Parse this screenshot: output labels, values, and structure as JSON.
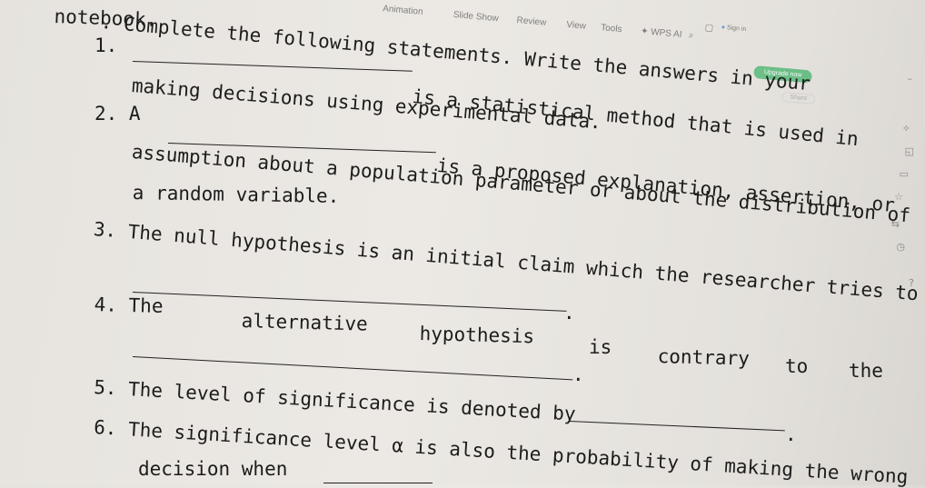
{
  "menu": {
    "animation": "Animation",
    "slide_show": "Slide Show",
    "review": "Review",
    "view": "View",
    "tools": "Tools",
    "wps_ai": "WPS AI",
    "sign_in": "Sign in",
    "upgrade": "Upgrade now",
    "share": "Share"
  },
  "worksheet": {
    "header_word": "notebook.",
    "q1_number": "1.",
    "instruction": "Complete the following statements. Write the answers in your",
    "q1_line1": "is a statistical method that is used in",
    "q1_line2": "making decisions using experimental data.",
    "q2_number": "2. A",
    "q2_line1": "is a proposed explanation, assertion, or",
    "q2_line2": "assumption about a population parameter or about the distribution of",
    "q2_line3": "a random variable.",
    "q3_line1": "3. The null hypothesis is an initial claim which the researcher tries to",
    "q4_the": "4. The",
    "q4_alternative": "alternative",
    "q4_hypothesis": "hypothesis",
    "q4_is": "is",
    "q4_contrary": "contrary",
    "q4_to": "to",
    "q4_the2": "the",
    "q5_line1": "5. The level of significance is denoted by",
    "q6_line1": "6. The significance level α is also the probability of making the wrong",
    "q6_line2": "decision when",
    "period": "."
  }
}
